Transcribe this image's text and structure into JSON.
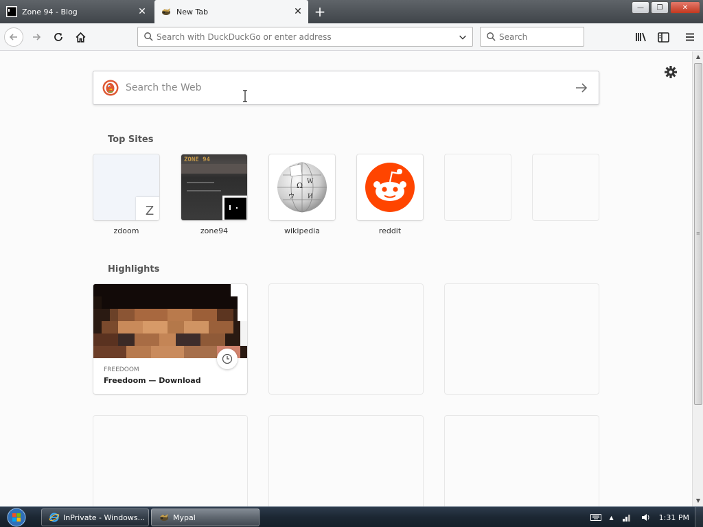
{
  "tabs": [
    {
      "title": "Zone 94 - Blog",
      "close": "✕",
      "active": false,
      "icon": "zone94-favicon"
    },
    {
      "title": "New Tab",
      "close": "✕",
      "active": true,
      "icon": "mypal-favicon"
    }
  ],
  "new_tab_button": "+",
  "window_controls": {
    "minimize": "—",
    "maximize": "❐",
    "close": "✕"
  },
  "nav": {
    "url_placeholder": "Search with DuckDuckGo or enter address",
    "url_value": "",
    "search_placeholder": "Search"
  },
  "newtab": {
    "websearch_placeholder": "Search the Web",
    "top_sites_title": "Top Sites",
    "top_sites": [
      {
        "label": "zdoom",
        "badge": "Z"
      },
      {
        "label": "zone94",
        "thumb_text": "ZONE 94"
      },
      {
        "label": "wikipedia"
      },
      {
        "label": "reddit"
      },
      {
        "label": ""
      },
      {
        "label": ""
      }
    ],
    "highlights_title": "Highlights",
    "highlights": [
      {
        "source": "FREEDOOM",
        "title": "Freedoom — Download"
      }
    ]
  },
  "taskbar": {
    "buttons": [
      {
        "label": "InPrivate - Windows...",
        "icon": "internet-explorer-icon"
      },
      {
        "label": "Mypal",
        "icon": "mypal-icon"
      }
    ],
    "clock": "1:31 PM",
    "tray_arrow": "▲"
  },
  "colors": {
    "accent": "#0a84ff",
    "reddit": "#ff4500",
    "ddg": "#de5833",
    "taskbar": "#1c2733"
  }
}
